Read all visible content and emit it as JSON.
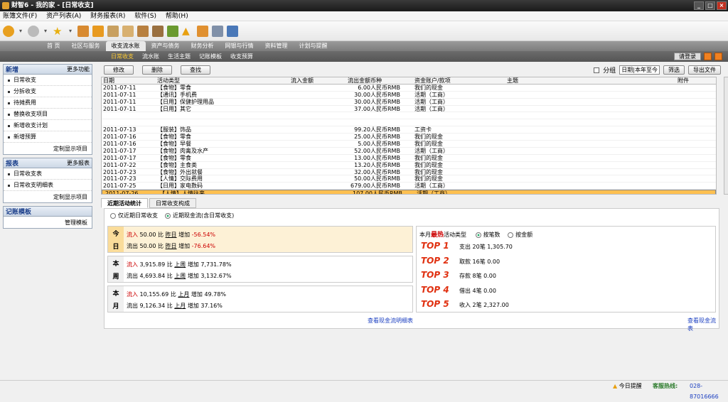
{
  "window": {
    "title": "财智6 - 我的家 - [日常收支]"
  },
  "menu": [
    "账簿文件(F)",
    "资产列表(A)",
    "财务报表(R)",
    "软件(S)",
    "帮助(H)"
  ],
  "nav_tabs": [
    "首 页",
    "社区与服务",
    "收支流水账",
    "资产与债务",
    "财务分析",
    "网银与行情",
    "资料管理",
    "计划与提醒"
  ],
  "sub_tabs": [
    "日常收支",
    "流水账",
    "生活主题",
    "记账模板",
    "收支预算"
  ],
  "login_label": "请登录",
  "sidebar": {
    "add": {
      "title": "新增",
      "more": "更多功能",
      "items": [
        "日常收支",
        "分拆收支",
        "待摊费用",
        "替换收支项目",
        "新增收支计划",
        "新增预算"
      ],
      "footer": "定制显示项目"
    },
    "reports": {
      "title": "报表",
      "more": "更多报表",
      "items": [
        "日常收支表",
        "日常收支明细表"
      ],
      "footer": "定制显示项目"
    },
    "templates": {
      "title": "记账模板",
      "footer": "管理模板"
    }
  },
  "actions": {
    "edit": "修改",
    "delete": "删除",
    "find": "查找",
    "group": "分组",
    "period": "日期|本年至今",
    "filter": "筛选",
    "export": "导出文件"
  },
  "grid": {
    "columns": [
      "日期",
      "活动类型",
      "流入金额",
      "流出金额",
      "币种",
      "资金账户/款项",
      "主题",
      "附件"
    ],
    "rows": [
      [
        "2011-07-11",
        "【食物】零食",
        "",
        "6.00",
        "人民币RMB",
        "我们的现金",
        "",
        ""
      ],
      [
        "2011-07-11",
        "【通讯】手机费",
        "",
        "30.00",
        "人民币RMB",
        "活期（工商）",
        "",
        ""
      ],
      [
        "2011-07-11",
        "【日用】保健护理用品",
        "",
        "30.00",
        "人民币RMB",
        "活期（工商）",
        "",
        ""
      ],
      [
        "2011-07-11",
        "【日用】其它",
        "",
        "37.00",
        "人民币RMB",
        "活期（工商）",
        "",
        ""
      ],
      [
        "",
        "",
        "",
        "",
        "",
        "",
        "",
        ""
      ],
      [
        "",
        "",
        "",
        "",
        "",
        "",
        "",
        ""
      ],
      [
        "2011-07-13",
        "【服装】饰品",
        "",
        "99.20",
        "人民币RMB",
        "工资卡",
        "",
        ""
      ],
      [
        "2011-07-16",
        "【食物】零食",
        "",
        "25.00",
        "人民币RMB",
        "我们的现金",
        "",
        ""
      ],
      [
        "2011-07-16",
        "【食物】早餐",
        "",
        "5.00",
        "人民币RMB",
        "我们的现金",
        "",
        ""
      ],
      [
        "2011-07-17",
        "【食物】肉禽及水产",
        "",
        "52.00",
        "人民币RMB",
        "活期（工商）",
        "",
        ""
      ],
      [
        "2011-07-17",
        "【食物】零食",
        "",
        "13.00",
        "人民币RMB",
        "我们的现金",
        "",
        ""
      ],
      [
        "2011-07-22",
        "【食物】主食类",
        "",
        "13.20",
        "人民币RMB",
        "我们的现金",
        "",
        ""
      ],
      [
        "2011-07-23",
        "【食物】外出就餐",
        "",
        "32.00",
        "人民币RMB",
        "我们的现金",
        "",
        ""
      ],
      [
        "2011-07-23",
        "【人情】交际费用",
        "",
        "50.00",
        "人民币RMB",
        "我们的现金",
        "",
        ""
      ],
      [
        "2011-07-25",
        "【日用】家电数码",
        "",
        "679.00",
        "人民币RMB",
        "活期（工商）",
        "",
        ""
      ],
      [
        "2011-07-26",
        "【人情】人情往来",
        "",
        "107.00",
        "人民币RMB",
        "活期（工商）",
        "",
        ""
      ]
    ]
  },
  "bottom_tabs": [
    "近期活动统计",
    "日常收支构成"
  ],
  "stats": {
    "radio1": "仅近期日常收支",
    "radio2": "近期现金流(含日常收支)",
    "today": {
      "l1": "今",
      "l2": "日",
      "in": "流入",
      "in_val": "50.00",
      "out": "流出",
      "out_val": "50.00",
      "cmp": "比",
      "prev": "昨日",
      "inc": "增加",
      "in_pct": "-56.54%",
      "out_pct": "-76.64%"
    },
    "week": {
      "l1": "本",
      "l2": "周",
      "in": "流入",
      "in_val": "3,915.89",
      "out": "流出",
      "out_val": "4,693.84",
      "cmp": "比",
      "prev": "上周",
      "inc": "增加",
      "in_pct": "7,731.78%",
      "out_pct": "3,132.67%"
    },
    "month": {
      "l1": "本",
      "l2": "月",
      "in": "流入",
      "in_val": "10,155.69",
      "out": "流出",
      "out_val": "9,126.34",
      "cmp": "比",
      "prev": "上月",
      "inc": "增加",
      "in_pct": "49.78%",
      "out_pct": "37.16%"
    },
    "link_left": "查看现金流明细表",
    "top_title_a": "本月",
    "top_title_b": "最热",
    "top_title_c": "活动类型",
    "by_count": "按笔数",
    "by_amount": "按金额",
    "top": [
      {
        "rank": "TOP 1",
        "text": "支出 20笔 1,305.70"
      },
      {
        "rank": "TOP 2",
        "text": "取款 16笔 0.00"
      },
      {
        "rank": "TOP 3",
        "text": "存款 8笔 0.00"
      },
      {
        "rank": "TOP 4",
        "text": "借出 4笔 0.00"
      },
      {
        "rank": "TOP 5",
        "text": "收入 2笔 2,327.00"
      }
    ],
    "link_right": "查看现金流表"
  },
  "status": {
    "reminder": "今日提醒",
    "hotline_label": "客服热线:",
    "hotline": "028-87016666"
  }
}
